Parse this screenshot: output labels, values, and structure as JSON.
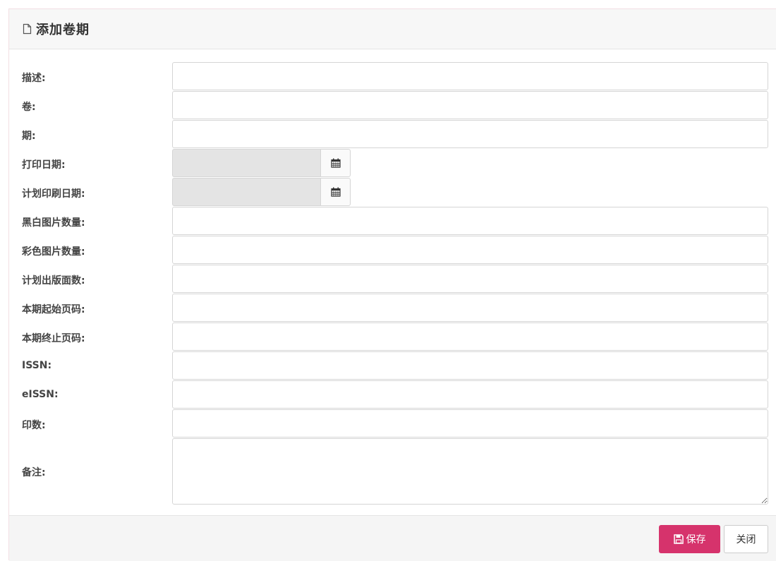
{
  "dialog": {
    "title": "添加卷期",
    "title_icon": "document-icon"
  },
  "form": {
    "description_label": "描述:",
    "description_value": "",
    "volume_label": "卷:",
    "volume_value": "",
    "issue_label": "期:",
    "issue_value": "",
    "print_date_label": "打印日期:",
    "print_date_value": "",
    "planned_print_date_label": "计划印刷日期:",
    "planned_print_date_value": "",
    "bw_images_label": "黑白图片数量:",
    "bw_images_value": "",
    "color_images_label": "彩色图片数量:",
    "color_images_value": "",
    "planned_pages_label": "计划出版面数:",
    "planned_pages_value": "",
    "start_page_label": "本期起始页码:",
    "start_page_value": "",
    "end_page_label": "本期终止页码:",
    "end_page_value": "",
    "issn_label": "ISSN:",
    "issn_value": "",
    "eissn_label": "eISSN:",
    "eissn_value": "",
    "print_count_label": "印数:",
    "print_count_value": "",
    "notes_label": "备注:",
    "notes_value": "",
    "calendar_icon": "calendar-icon"
  },
  "footer": {
    "save_label": "保存",
    "save_icon": "save-icon",
    "close_label": "关闭"
  },
  "colors": {
    "save_button": "#d6336c",
    "header_bg": "#f7f7f7",
    "readonly_bg": "#e4e4e4"
  }
}
